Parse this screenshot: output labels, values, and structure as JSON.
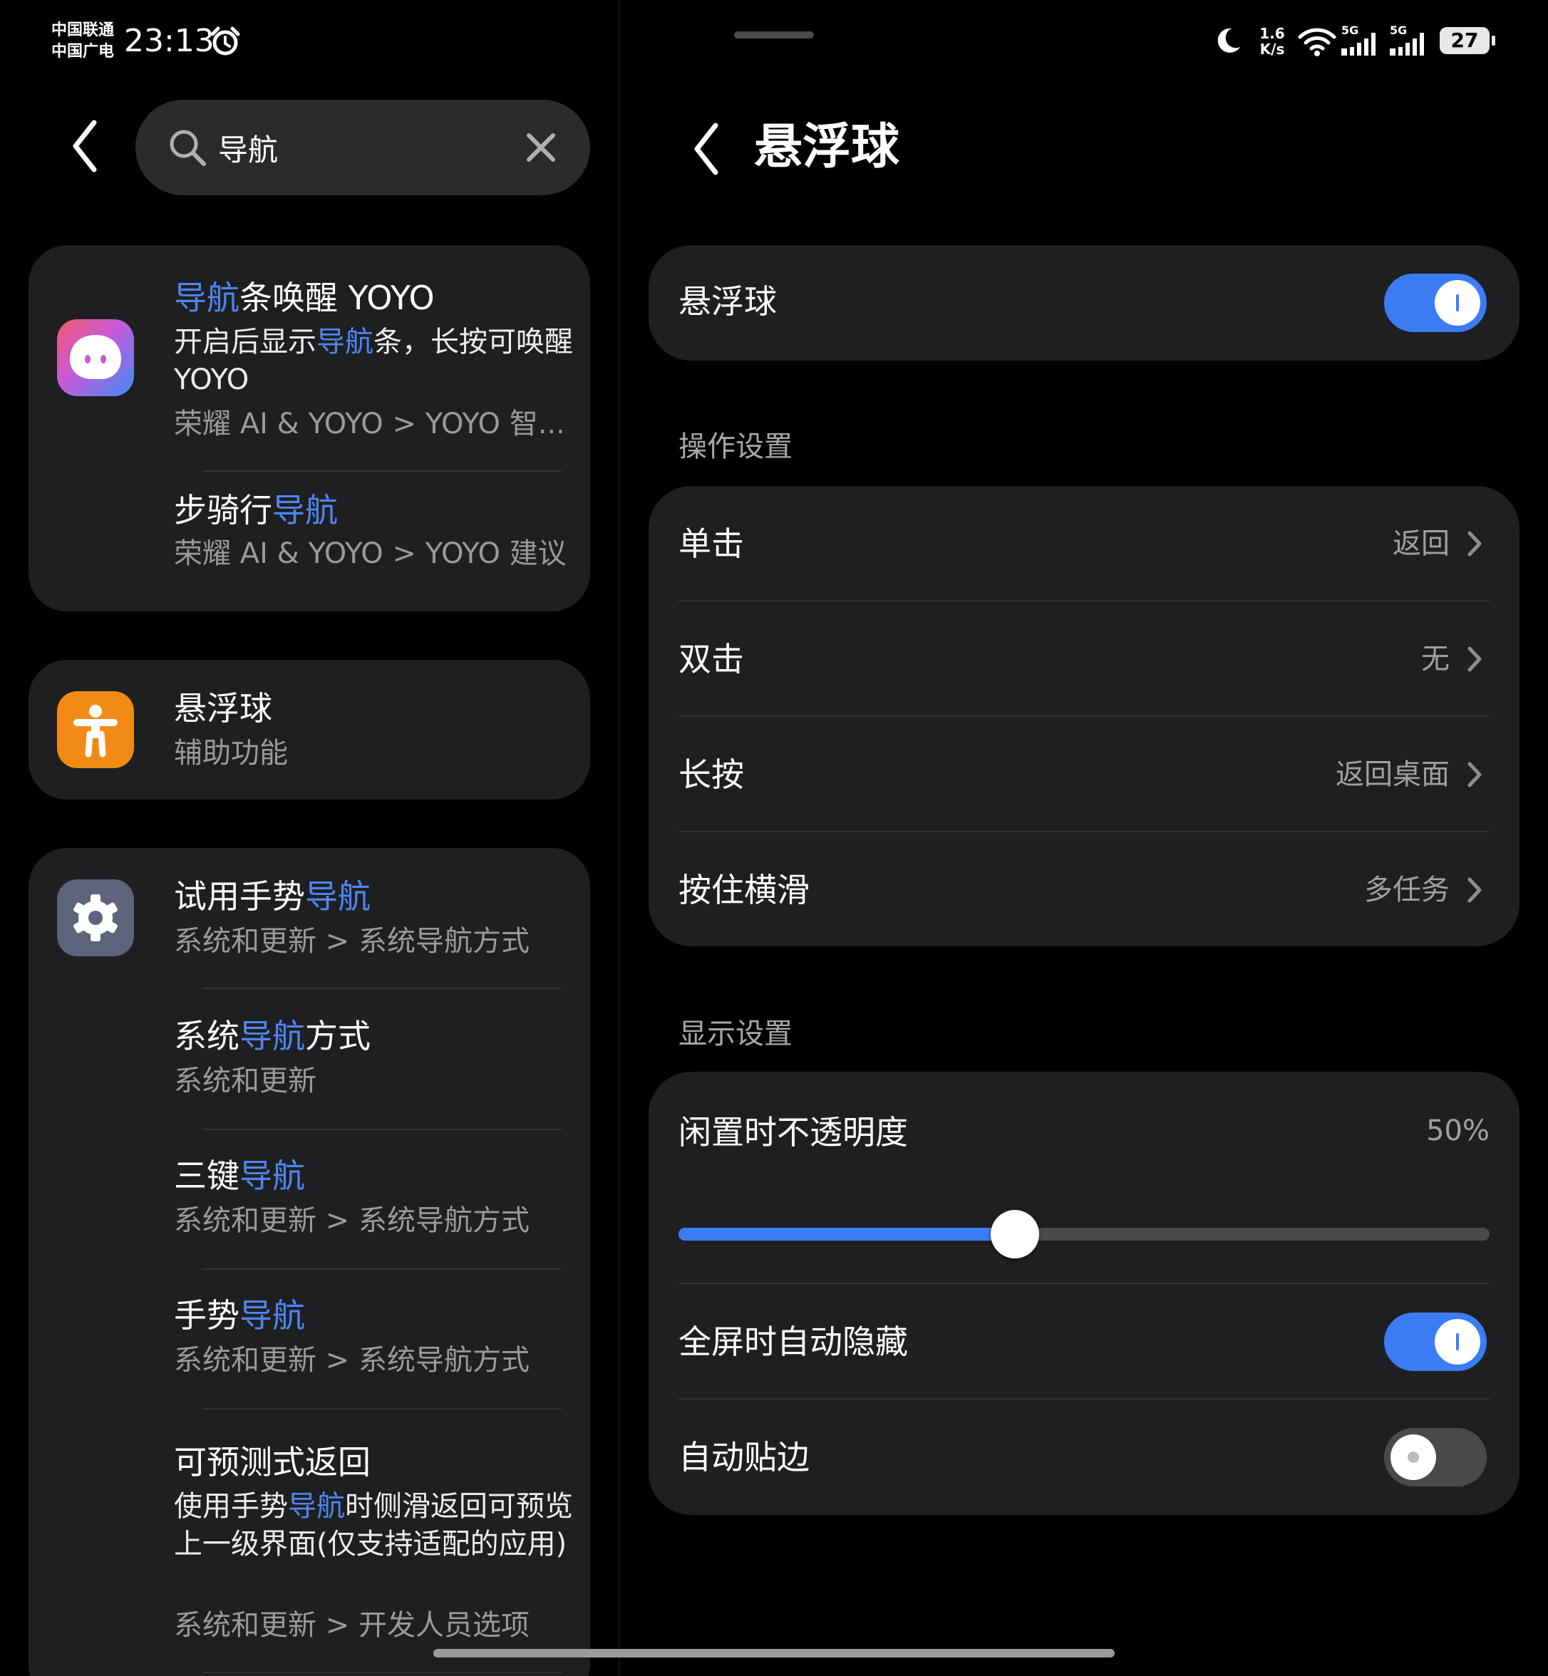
{
  "status_bar": {
    "carrier_1": "中国联通",
    "carrier_2": "中国广电",
    "time": "23:13",
    "net_speed_value": "1.6",
    "net_speed_unit": "K/s",
    "network_1": "5G",
    "network_2": "5G",
    "battery": "27"
  },
  "search": {
    "query": "导航"
  },
  "results": {
    "group_1": [
      {
        "icon": "yoyo-assistant-icon",
        "title_parts": [
          {
            "text": "导航",
            "hl": true
          },
          {
            "text": "条唤醒 YOYO",
            "hl": false
          }
        ],
        "desc_parts": [
          {
            "text": "开启后显示",
            "hl": false
          },
          {
            "text": "导航",
            "hl": true
          },
          {
            "text": "条，长按可唤醒 YOYO",
            "hl": false
          }
        ],
        "path": "荣耀 AI & YOYO > YOYO 智..."
      },
      {
        "title_parts": [
          {
            "text": "步骑行",
            "hl": false
          },
          {
            "text": "导航",
            "hl": true
          }
        ],
        "path": "荣耀 AI & YOYO > YOYO 建议"
      }
    ],
    "group_2": [
      {
        "icon": "accessibility-icon",
        "title_parts": [
          {
            "text": "悬浮球",
            "hl": false
          }
        ],
        "path": "辅助功能"
      }
    ],
    "group_3": [
      {
        "icon": "settings-gear-icon",
        "title_parts": [
          {
            "text": "试用手势",
            "hl": false
          },
          {
            "text": "导航",
            "hl": true
          }
        ],
        "path": "系统和更新 > 系统导航方式"
      },
      {
        "title_parts": [
          {
            "text": "系统",
            "hl": false
          },
          {
            "text": "导航",
            "hl": true
          },
          {
            "text": "方式",
            "hl": false
          }
        ],
        "path": "系统和更新"
      },
      {
        "title_parts": [
          {
            "text": "三键",
            "hl": false
          },
          {
            "text": "导航",
            "hl": true
          }
        ],
        "path": "系统和更新 > 系统导航方式"
      },
      {
        "title_parts": [
          {
            "text": "手势",
            "hl": false
          },
          {
            "text": "导航",
            "hl": true
          }
        ],
        "path": "系统和更新 > 系统导航方式"
      },
      {
        "title_parts": [
          {
            "text": "可预测式返回",
            "hl": false
          }
        ],
        "desc_parts": [
          {
            "text": "使用手势",
            "hl": false
          },
          {
            "text": "导航",
            "hl": true
          },
          {
            "text": "时侧滑返回可预览上一级界面(仅支持适配的应用)",
            "hl": false
          }
        ],
        "path": "系统和更新 > 开发人员选项"
      }
    ]
  },
  "detail": {
    "title": "悬浮球",
    "main_toggle": {
      "label": "悬浮球",
      "on": true
    },
    "operation_header": "操作设置",
    "operations": [
      {
        "label": "单击",
        "value": "返回"
      },
      {
        "label": "双击",
        "value": "无"
      },
      {
        "label": "长按",
        "value": "返回桌面"
      },
      {
        "label": "按住横滑",
        "value": "多任务"
      }
    ],
    "display_header": "显示设置",
    "opacity": {
      "label": "闲置时不透明度",
      "value_text": "50%",
      "level": 0.415
    },
    "fullscreen_hide": {
      "label": "全屏时自动隐藏",
      "on": true
    },
    "auto_edge": {
      "label": "自动贴边",
      "on": false
    }
  },
  "colors": {
    "accent": "#3b7cf5",
    "highlight_text": "#4e85f2",
    "card_bg": "#1f1f21",
    "accessibility_orange": "#f18a14",
    "settings_gray": "#5d6378"
  }
}
